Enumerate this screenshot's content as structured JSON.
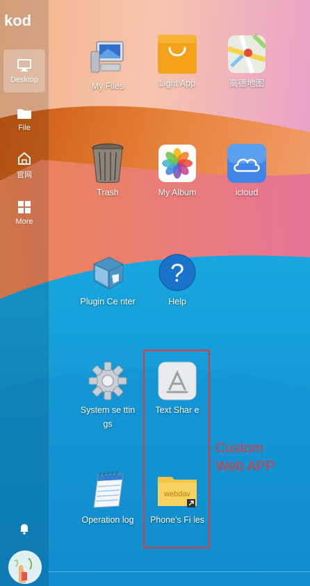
{
  "app": {
    "logo_text": "kod"
  },
  "sidebar": {
    "items": [
      {
        "label": "Desktop",
        "icon": "monitor-icon",
        "active": true
      },
      {
        "label": "File",
        "icon": "folder-icon"
      },
      {
        "label": "官网",
        "icon": "home-icon"
      },
      {
        "label": "More",
        "icon": "grid-icon"
      }
    ],
    "bell_icon": "bell-icon",
    "avatar_icon": "avatar-icon"
  },
  "desktop": {
    "icons": [
      {
        "name": "My Files",
        "icon": "computer-icon"
      },
      {
        "name": "Light App",
        "icon": "shopping-bag-icon"
      },
      {
        "name": "高德地图",
        "icon": "map-icon"
      },
      {
        "name": "Trash",
        "icon": "trash-icon"
      },
      {
        "name": "My Album",
        "icon": "photos-icon"
      },
      {
        "name": "icloud",
        "icon": "cloud-icon"
      },
      {
        "name": "Plugin Ce nter",
        "icon": "plugin-icon"
      },
      {
        "name": "Help",
        "icon": "help-icon"
      },
      {
        "name": "System se ttings",
        "icon": "gear-icon"
      },
      {
        "name": "Text Shar e",
        "icon": "app-store-icon"
      },
      {
        "name": "Operation log",
        "icon": "notepad-icon"
      },
      {
        "name": "Phone's Fi les",
        "icon": "webdav-folder-icon",
        "folder_label": "webdav"
      }
    ]
  },
  "annotation": {
    "line1": "Custom",
    "line2": "Web APP",
    "color": "#e53935"
  },
  "colors": {
    "sky_blue": "#1a8fd0",
    "orange": "#e58a3d",
    "pink": "#e9a3c0"
  }
}
